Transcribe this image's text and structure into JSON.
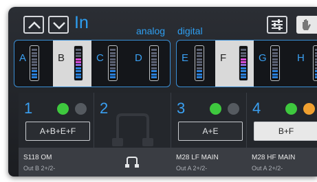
{
  "header": {
    "input_label": "In",
    "group_analog": "analog",
    "group_digital": "digital"
  },
  "inputs": {
    "analog": [
      {
        "label": "A",
        "selected": false
      },
      {
        "label": "B",
        "selected": true
      },
      {
        "label": "C",
        "selected": false
      },
      {
        "label": "D",
        "selected": false
      }
    ],
    "digital": [
      {
        "label": "E",
        "selected": false
      },
      {
        "label": "F",
        "selected": true
      },
      {
        "label": "G",
        "selected": false
      },
      {
        "label": "H",
        "selected": false
      }
    ]
  },
  "outputs": [
    {
      "num": "1",
      "route": "A+B+E+F",
      "name": "S118 OM",
      "sub": "Out B 2+/2-"
    },
    {
      "num": "2",
      "route": "",
      "name": "",
      "sub": ""
    },
    {
      "num": "3",
      "route": "A+E",
      "name": "M28 LF MAIN",
      "sub": "Out A 2+/2-"
    },
    {
      "num": "4",
      "route": "B+F",
      "name": "M28 HF MAIN",
      "sub": "Out A 2+/2-"
    }
  ],
  "colors": {
    "accent": "#2e9ef0",
    "green": "#3ec83e",
    "orange": "#f0a030",
    "gray": "#555a60"
  },
  "icons": {
    "up": "chevron-up-icon",
    "down": "chevron-down-icon",
    "settings": "sliders-icon",
    "hand": "hand-icon",
    "link": "link-icon"
  }
}
